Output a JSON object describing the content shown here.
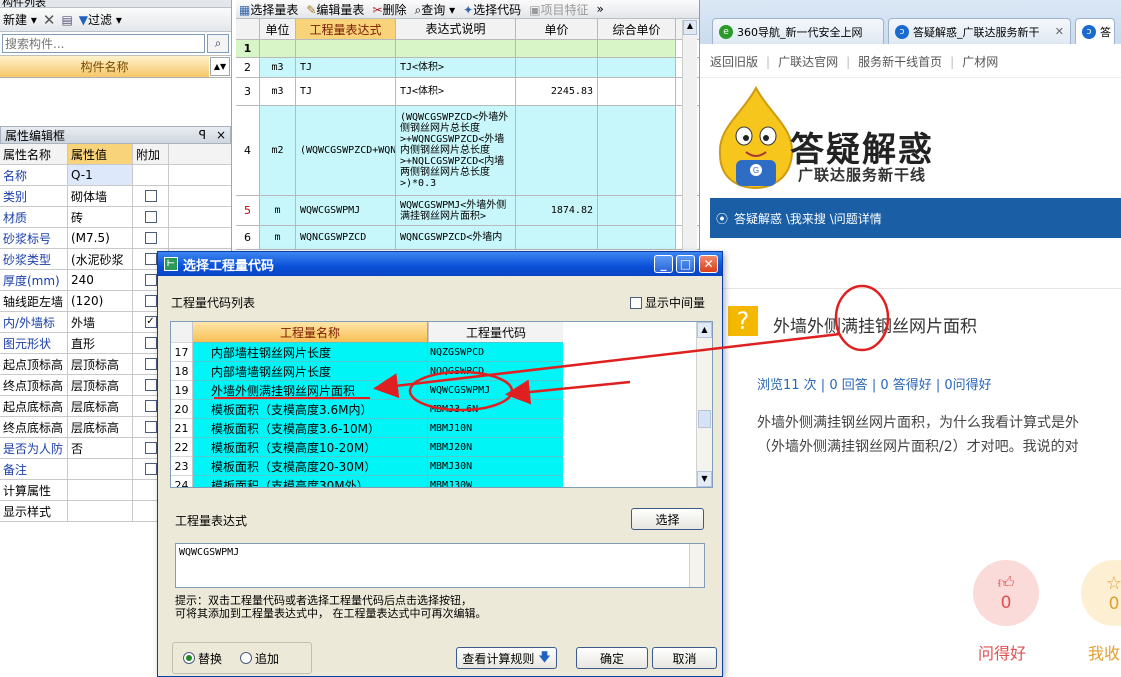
{
  "left_panel": {
    "top_label": "构件列表",
    "toolbar": {
      "new": "新建",
      "filter": "过滤"
    },
    "search_placeholder": "搜索构件...",
    "header": "构件名称",
    "prop_panel_title": "属性编辑框",
    "pin": "ꟼ",
    "close": "×",
    "columns": [
      "属性名称",
      "属性值",
      "附加"
    ],
    "rows": [
      {
        "name": "名称",
        "value": "Q-1",
        "blue": true,
        "check": null
      },
      {
        "name": "类别",
        "value": "砌体墙",
        "blue": true,
        "check": false
      },
      {
        "name": "材质",
        "value": "砖",
        "blue": true,
        "check": false
      },
      {
        "name": "砂浆标号",
        "value": "(M7.5)",
        "blue": true,
        "check": false
      },
      {
        "name": "砂浆类型",
        "value": "(水泥砂浆",
        "blue": true,
        "check": false
      },
      {
        "name": "厚度(mm)",
        "value": "240",
        "blue": true,
        "check": false
      },
      {
        "name": "轴线距左墙",
        "value": "(120)",
        "blue": false,
        "check": false
      },
      {
        "name": "内/外墙标",
        "value": "外墙",
        "blue": true,
        "check": true
      },
      {
        "name": "图元形状",
        "value": "直形",
        "blue": true,
        "check": false
      },
      {
        "name": "起点顶标高",
        "value": "层顶标高",
        "blue": false,
        "check": false
      },
      {
        "name": "终点顶标高",
        "value": "层顶标高",
        "blue": false,
        "check": false
      },
      {
        "name": "起点底标高",
        "value": "层底标高",
        "blue": false,
        "check": false
      },
      {
        "name": "终点底标高",
        "value": "层底标高",
        "blue": false,
        "check": false
      },
      {
        "name": "是否为人防",
        "value": "否",
        "blue": true,
        "check": false
      },
      {
        "name": "备注",
        "value": "",
        "blue": true,
        "check": false
      },
      {
        "name": "计算属性",
        "value": "",
        "blue": false,
        "check": null
      },
      {
        "name": "显示样式",
        "value": "",
        "blue": false,
        "check": null
      }
    ]
  },
  "mid_table": {
    "toolbar": {
      "select_table": "选择量表",
      "edit_table": "编辑量表",
      "delete": "删除",
      "query": "查询",
      "select_code": "选择代码",
      "item_feature": "项目特征",
      "more": "»"
    },
    "columns": [
      "单位",
      "工程量表达式",
      "表达式说明",
      "单价",
      "综合单价"
    ],
    "rows": [
      {
        "n": "1",
        "unit": "",
        "expr": "",
        "desc": "",
        "price": "",
        "comp": ""
      },
      {
        "n": "2",
        "unit": "m3",
        "expr": "TJ",
        "desc": "TJ<体积>",
        "price": "",
        "comp": ""
      },
      {
        "n": "3",
        "unit": "m3",
        "expr": "TJ",
        "desc": "TJ<体积>",
        "price": "2245.83",
        "comp": ""
      },
      {
        "n": "4",
        "unit": "m2",
        "expr": "(WQWCGSWPZCD+WQNCGSWPZCD+NQLCGSWPZCD)*0.3",
        "desc": "(WQWCGSWPZCD<外墙外侧钢丝网片总长度>+WQNCGSWPZCD<外墙内侧钢丝网片总长度>+NQLCGSWPZCD<内墙两侧钢丝网片总长度>)*0.3",
        "price": "",
        "comp": ""
      },
      {
        "n": "5",
        "unit": "m",
        "expr": "WQWCGSWPMJ",
        "desc": "WQWCGSWPMJ<外墙外侧满挂钢丝网片面积>",
        "price": "1874.82",
        "comp": ""
      },
      {
        "n": "6",
        "unit": "m",
        "expr": "WQNCGSWPZCD",
        "desc": "WQNCGSWPZCD<外墙内",
        "price": "",
        "comp": ""
      }
    ]
  },
  "browser": {
    "tabs": [
      "360导航_新一代安全上网",
      "答疑解惑_广联达服务新干",
      "答"
    ],
    "nav_links": [
      "返回旧版",
      "广联达官网",
      "服务新干线首页",
      "广材网"
    ],
    "logo_main": "答疑解惑",
    "logo_sub": "广联达服务新干线",
    "breadcrumb": "答疑解惑 \\我来搜 \\问题详情",
    "question_title": "外墙外侧满挂钢丝网片面积",
    "stats": "浏览11 次 | 0 回答 | 0 答得好 | 0问得好",
    "body_line1": "外墙外侧满挂钢丝网片面积，为什么我看计算式是外",
    "body_line2": "（外墙外侧满挂钢丝网片面积/2）才对吧。我说的对",
    "like_count": "0",
    "like_label": "问得好",
    "fav_count": "0",
    "fav_label": "我收"
  },
  "dialog": {
    "title": "选择工程量代码",
    "list_label": "工程量代码列表",
    "show_intermediate": "显示中间量",
    "col_name": "工程量名称",
    "col_code": "工程量代码",
    "rows": [
      {
        "n": "17",
        "name": "内部墙柱钢丝网片长度",
        "code": "NQZGSWPCD"
      },
      {
        "n": "18",
        "name": "内部墙墙钢丝网片长度",
        "code": "NQQGSWPCD"
      },
      {
        "n": "19",
        "name": "外墙外侧满挂钢丝网片面积",
        "code": "WQWCGSWPMJ"
      },
      {
        "n": "20",
        "name": "模板面积（支模高度3.6M内）",
        "code": "MBMJ3.6N"
      },
      {
        "n": "21",
        "name": "模板面积（支模高度3.6-10M）",
        "code": "MBMJ10N"
      },
      {
        "n": "22",
        "name": "模板面积（支模高度10-20M）",
        "code": "MBMJ20N"
      },
      {
        "n": "23",
        "name": "模板面积（支模高度20-30M）",
        "code": "MBMJ30N"
      },
      {
        "n": "24",
        "name": "模板面积（支模高度30M外）",
        "code": "MBMJ30W"
      }
    ],
    "expr_label": "工程量表达式",
    "select_btn": "选择",
    "expr_value": "WQWCGSWPMJ",
    "hint_line1": "提示：双击工程量代码或者选择工程量代码后点击选择按钮，",
    "hint_line2": "可将其添加到工程量表达式中， 在工程量表达式中可再次编辑。",
    "radio_replace": "替换",
    "radio_append": "追加",
    "view_rules": "查看计算规则",
    "ok": "确定",
    "cancel": "取消"
  },
  "colors": {
    "cyan": "#00f5f7",
    "annotation_red": "#e02020",
    "dialog_title": "#0a50d8"
  }
}
